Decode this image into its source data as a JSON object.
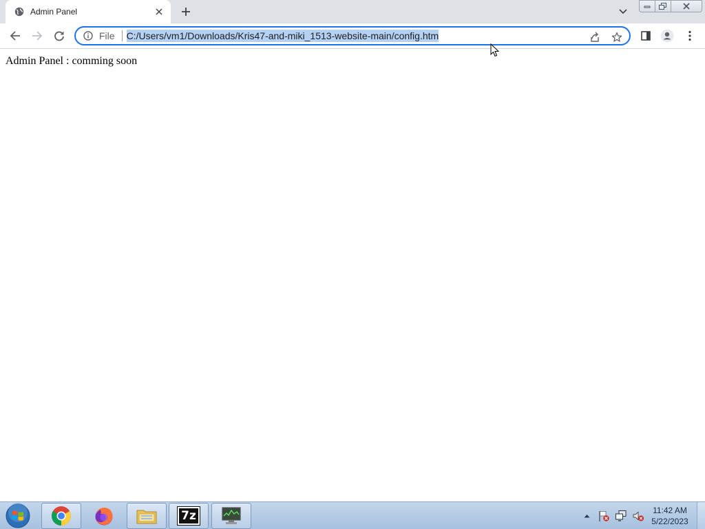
{
  "browser": {
    "tab": {
      "title": "Admin Panel",
      "favicon": "globe-icon"
    },
    "toolbar": {
      "scheme_label": "File",
      "url": "C:/Users/vm1/Downloads/Kris47-and-miki_1513-website-main/config.htm",
      "icons": [
        "back-arrow-icon",
        "forward-arrow-icon",
        "reload-icon",
        "info-icon",
        "share-icon",
        "star-icon",
        "side-panel-icon",
        "profile-icon",
        "menu-icon"
      ]
    },
    "accent_color": "#1a73e8",
    "selection_color": "#b4d1f3"
  },
  "page": {
    "text": "Admin Panel : comming soon"
  },
  "taskbar": {
    "apps": [
      "chrome-icon",
      "firefox-icon",
      "file-explorer-icon",
      "7zip-icon",
      "monitor-app-icon"
    ],
    "sevenzip_label": "7z",
    "clock": {
      "time": "11:42 AM",
      "date": "5/22/2023"
    }
  }
}
